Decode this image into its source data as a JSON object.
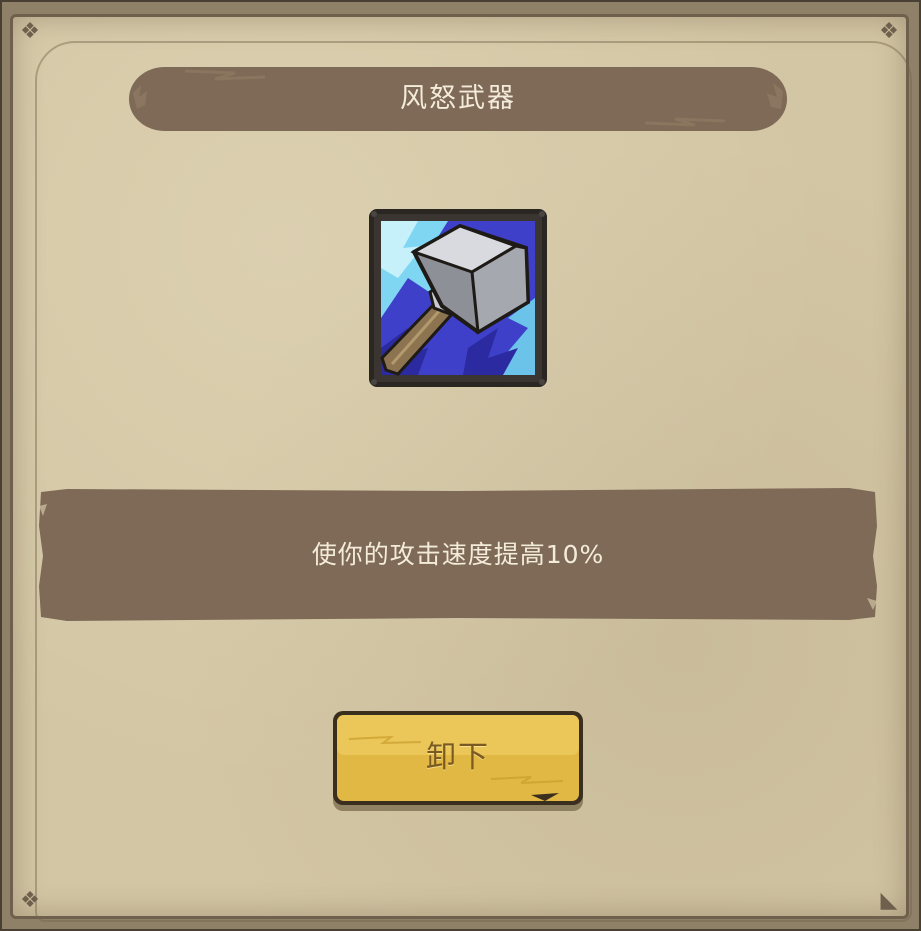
{
  "dialog": {
    "title": "风怒武器",
    "item": {
      "icon": "hammer-icon",
      "description": "使你的攻击速度提高10%"
    },
    "action_button": {
      "label": "卸下"
    }
  },
  "colors": {
    "panel": "#d3c6a4",
    "banner": "#7e6a57",
    "button": "#e1b843",
    "text_light": "#f4ecda"
  }
}
